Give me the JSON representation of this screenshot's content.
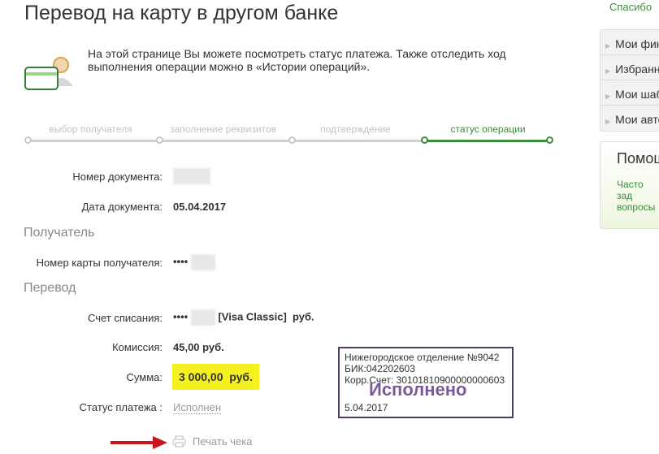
{
  "page_title": "Перевод на карту в другом банке",
  "intro": "На этой странице Вы можете посмотреть статус платежа. Также отследить ход выполнения операции можно в «Истории операций».",
  "steps": [
    {
      "label": "выбор получателя"
    },
    {
      "label": "заполнение реквизитов"
    },
    {
      "label": "подтверждение"
    },
    {
      "label": "статус операции"
    }
  ],
  "current_step": 4,
  "fields": {
    "doc_number_label": "Номер документа:",
    "doc_date_label": "Дата документа:",
    "doc_date": "05.04.2017",
    "recipient_section": "Получатель",
    "card_label": "Номер карты получателя:",
    "card_mask": "••••",
    "transfer_section": "Перевод",
    "account_label": "Счет списания:",
    "account_mask": "••••",
    "account_type": "[Visa Classic]",
    "account_currency": "руб.",
    "fee_label": "Комиссия:",
    "fee": "45,00 руб.",
    "amount_label": "Сумма:",
    "amount": "3 000,00  руб.",
    "status_label": "Статус платежа :",
    "status": "Исполнен"
  },
  "print_label": "Печать чека",
  "stamp": {
    "line1": "Нижегородское отделение №9042",
    "line2": "БИК:042202603",
    "line3": "Корр.Счет: 30101810900000000603",
    "status": "Исполнено",
    "date": "5.04.2017"
  },
  "sidebar": {
    "top_link": "Спасибо",
    "items": [
      {
        "label": "Мои фин"
      },
      {
        "label": "Избранн"
      },
      {
        "label": "Мои шаб"
      },
      {
        "label": "Мои авто"
      }
    ],
    "help_title": "Помощ",
    "help_link": "Часто зад вопросы"
  },
  "colors": {
    "accent": "#3a8d3a",
    "highlight": "#f5f01f",
    "stamp": "#4f3b63",
    "arrow": "#c8161d"
  }
}
